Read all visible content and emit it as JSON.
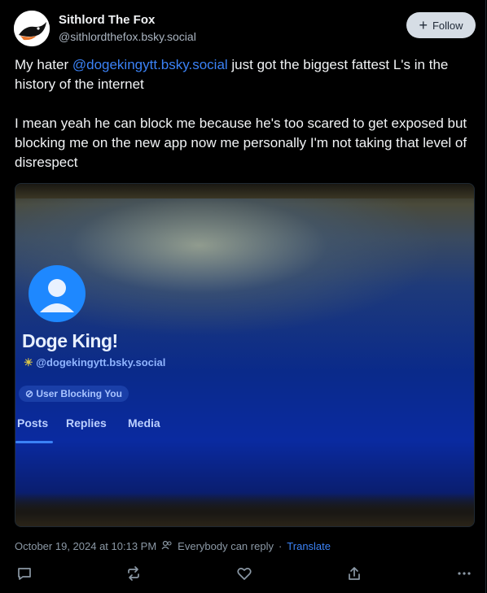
{
  "post": {
    "author": {
      "display_name": "Sithlord The Fox",
      "handle": "@sithlordthefox.bsky.social"
    },
    "follow_label": "Follow",
    "text": {
      "line1_prefix": "My hater ",
      "mention": "@dogekingytt.bsky.social",
      "line1_suffix": " just got the biggest fattest L's in the history of the internet",
      "paragraph2": "I mean yeah he can block me because he's too scared to get exposed but blocking me on the new app now me personally I'm not taking that level of disrespect"
    },
    "image": {
      "profile_name": "Doge King!",
      "profile_handle": "@dogekingytt.bsky.social",
      "blocking_badge": "User Blocking You",
      "tabs": [
        "Posts",
        "Replies",
        "Media"
      ]
    },
    "meta": {
      "timestamp": "October 19, 2024 at 10:13 PM",
      "reply_setting": "Everybody can reply",
      "separator": "·",
      "translate": "Translate"
    },
    "actions": {
      "icons": [
        "reply-icon",
        "repost-icon",
        "like-icon",
        "share-icon",
        "more-icon"
      ]
    }
  }
}
